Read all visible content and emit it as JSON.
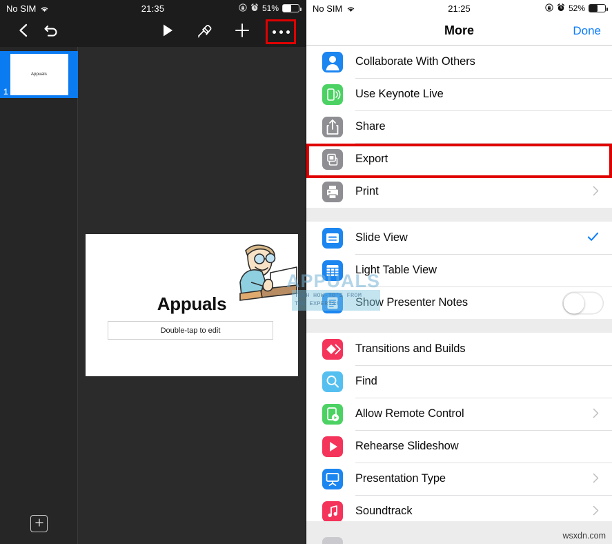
{
  "left": {
    "status": {
      "carrier": "No SIM",
      "wifi_icon": "wifi-icon",
      "time": "21:35",
      "lock_rotation_icon": "rotation-lock-icon",
      "alarm_icon": "alarm-clock-icon",
      "battery_percent": "51%"
    },
    "toolbar": {
      "back_icon": "chevron-left-icon",
      "undo_icon": "undo-arrow-icon",
      "play_icon": "play-triangle-icon",
      "format_icon": "paintbrush-icon",
      "add_icon": "plus-icon",
      "more_icon": "ellipsis-icon",
      "more_highlight_color": "#e00000"
    },
    "navigator": {
      "thumbnail_title": "Appuals",
      "slide_number": "1",
      "selected_color": "#0b7bf2",
      "add_slide_icon": "plus-icon"
    },
    "slide": {
      "title": "Appuals",
      "subtitle": "Double-tap to edit",
      "clipart_icon": "man-at-laptop-clipart"
    }
  },
  "right": {
    "status": {
      "carrier": "No SIM",
      "wifi_icon": "wifi-icon",
      "time": "21:25",
      "lock_rotation_icon": "rotation-lock-icon",
      "alarm_icon": "alarm-clock-icon",
      "battery_percent": "52%"
    },
    "navbar": {
      "title": "More",
      "done_label": "Done",
      "done_color": "#0a7cff"
    },
    "highlight": {
      "target": "Export",
      "color": "#e00000"
    },
    "groups": [
      {
        "items": [
          {
            "label": "Collaborate With Others",
            "icon": "person-icon",
            "icon_color": "#1b85f0",
            "accessory": "none"
          },
          {
            "label": "Use Keynote Live",
            "icon": "phone-broadcast-icon",
            "icon_color": "#4cd263",
            "accessory": "none"
          },
          {
            "label": "Share",
            "icon": "share-upload-icon",
            "icon_color": "#8e8e93",
            "accessory": "none"
          },
          {
            "label": "Export",
            "icon": "export-copy-icon",
            "icon_color": "#8e8e93",
            "accessory": "none"
          },
          {
            "label": "Print",
            "icon": "printer-icon",
            "icon_color": "#8e8e93",
            "accessory": "chevron"
          }
        ]
      },
      {
        "items": [
          {
            "label": "Slide View",
            "icon": "slide-view-icon",
            "icon_color": "#1b85f0",
            "accessory": "check"
          },
          {
            "label": "Light Table View",
            "icon": "grid-table-icon",
            "icon_color": "#1b85f0",
            "accessory": "none"
          },
          {
            "label": "Show Presenter Notes",
            "icon": "notes-icon",
            "icon_color": "#1b85f0",
            "accessory": "switch",
            "switch_on": false
          }
        ]
      },
      {
        "items": [
          {
            "label": "Transitions and Builds",
            "icon": "transitions-diamond-icon",
            "icon_color": "#f4345a",
            "accessory": "none"
          },
          {
            "label": "Find",
            "icon": "search-icon",
            "icon_color": "#55c0f0",
            "accessory": "none"
          },
          {
            "label": "Allow Remote Control",
            "icon": "remote-control-icon",
            "icon_color": "#4cd263",
            "accessory": "chevron"
          },
          {
            "label": "Rehearse Slideshow",
            "icon": "play-rehearse-icon",
            "icon_color": "#f4345a",
            "accessory": "none"
          },
          {
            "label": "Presentation Type",
            "icon": "projector-screen-icon",
            "icon_color": "#1b85f0",
            "accessory": "chevron"
          },
          {
            "label": "Soundtrack",
            "icon": "music-note-icon",
            "icon_color": "#f4345a",
            "accessory": "chevron"
          }
        ]
      }
    ],
    "footer_credit": "wsxdn.com"
  },
  "watermark": {
    "brand": "APPUALS",
    "tagline_line1": "TECH HOW-TO'S FROM",
    "tagline_line2": "THE EXPERTS!"
  }
}
